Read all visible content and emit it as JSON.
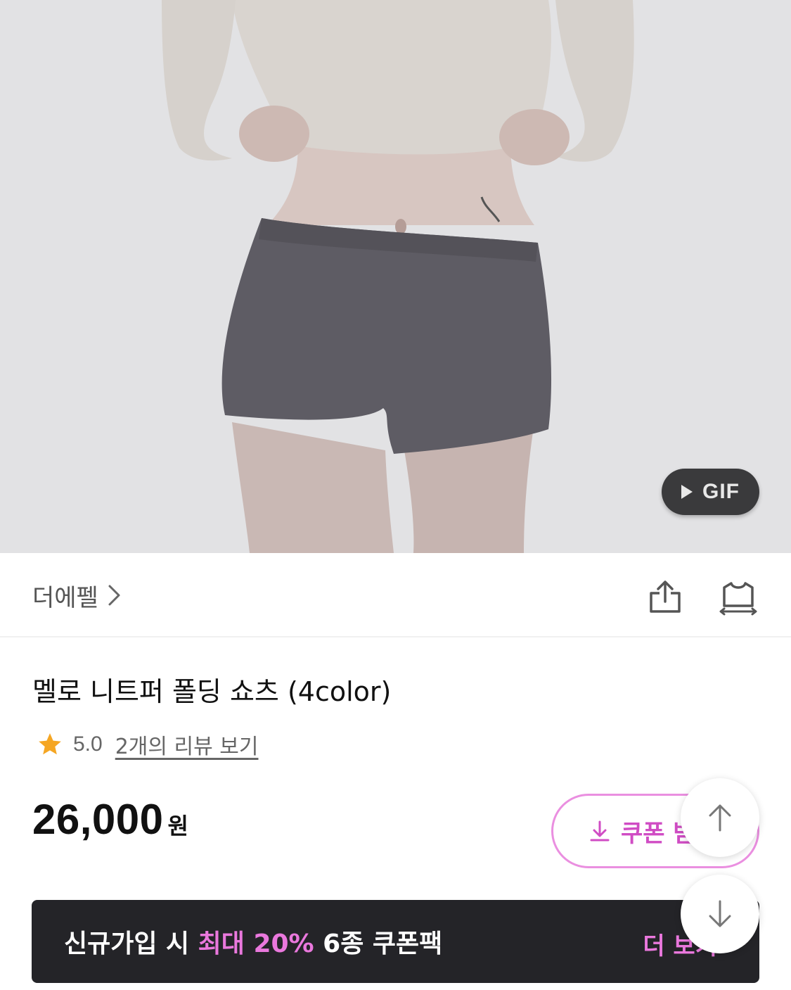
{
  "hero": {
    "gif_label": "GIF",
    "icons": {
      "play": "play-icon"
    }
  },
  "brand": {
    "name": "더에펠",
    "icons": {
      "chevron": "chevron-right-icon",
      "share": "share-icon",
      "fit": "clothing-size-icon"
    }
  },
  "product": {
    "title": "멜로 니트퍼 폴딩 쇼츠 (4color)",
    "rating": "5.0",
    "review_link": "2개의 리뷰 보기",
    "price": "26,000",
    "price_unit": "원"
  },
  "coupon": {
    "label": "쿠폰 받",
    "icon": "download-icon"
  },
  "banner": {
    "text_prefix": "신규가입 시 ",
    "text_accent": "최대 20%",
    "text_suffix": " 6종 쿠폰팩",
    "more": "더 보기"
  },
  "fab": {
    "up_icon": "arrow-up-icon",
    "down_icon": "arrow-down-icon"
  },
  "colors": {
    "accent_pink": "#ea78dd",
    "star": "#f5a623",
    "banner_bg": "#242428"
  }
}
